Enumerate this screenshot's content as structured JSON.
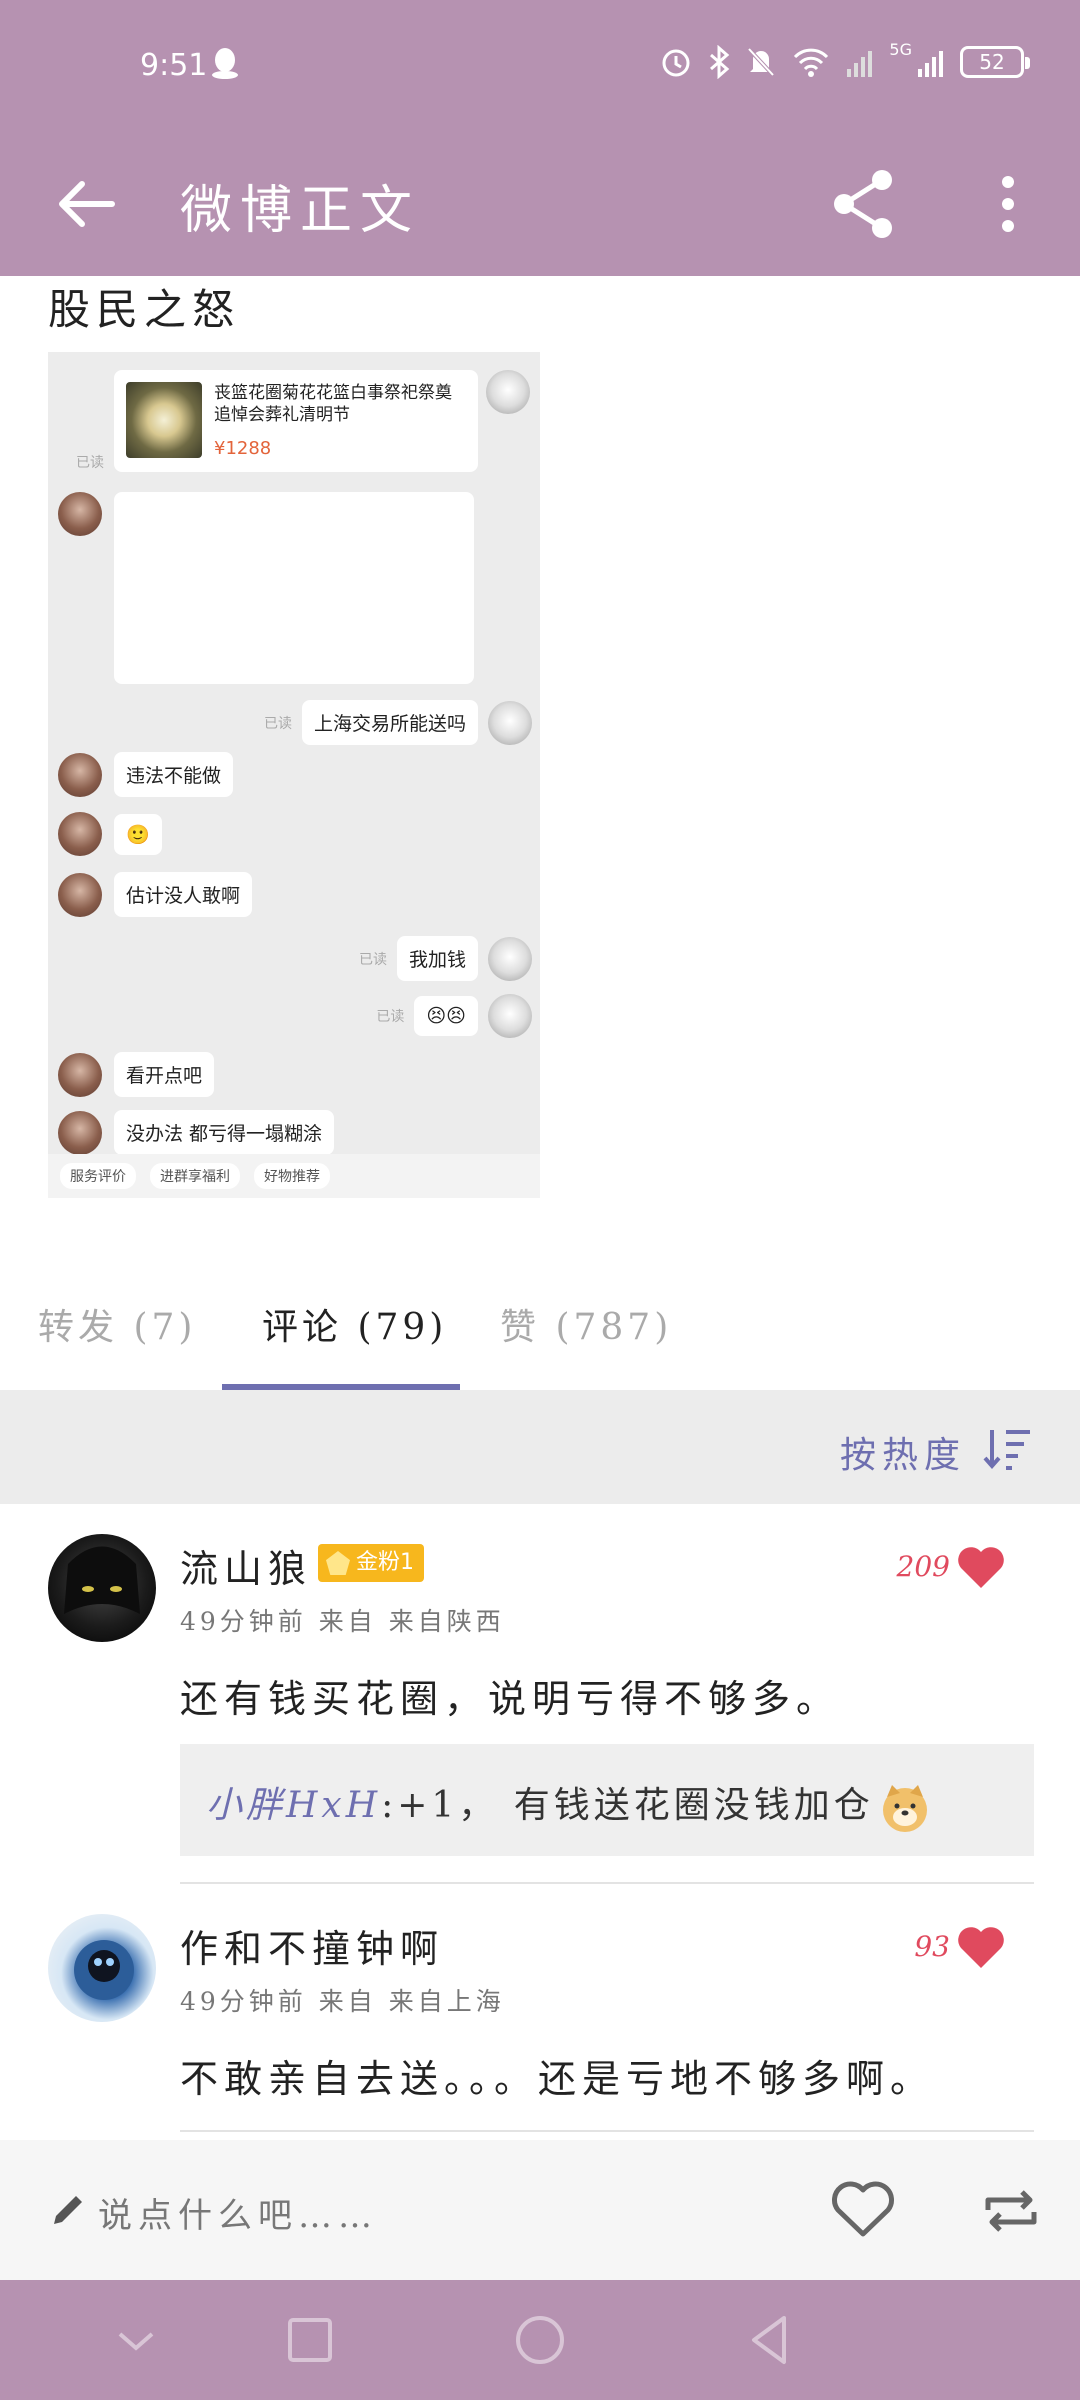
{
  "status_bar": {
    "time": "9:51",
    "battery": "52",
    "network": "5G"
  },
  "app_bar": {
    "title": "微博正文"
  },
  "post": {
    "text": "股民之怒",
    "chat": {
      "product_title": "丧篮花圈菊花花篮白事祭祀祭奠追悼会葬礼清明节",
      "product_price": "¥1288",
      "read_label": "已读",
      "messages": [
        {
          "side": "right",
          "text": "上海交易所能送吗"
        },
        {
          "side": "left",
          "text": "违法不能做"
        },
        {
          "side": "left",
          "text": "🙂"
        },
        {
          "side": "left",
          "text": "估计没人敢啊"
        },
        {
          "side": "right",
          "text": "我加钱"
        },
        {
          "side": "right",
          "text": "😣😣"
        },
        {
          "side": "left",
          "text": "看开点吧"
        },
        {
          "side": "left",
          "text": "没办法 都亏得一塌糊涂"
        }
      ],
      "bottom_chips": [
        "服务评价",
        "进群享福利",
        "好物推荐"
      ]
    }
  },
  "tabs": {
    "repost": "转发 (7)",
    "comments": "评论 (79)",
    "likes": "赞 (787)"
  },
  "sort": {
    "label": "按热度"
  },
  "comments": [
    {
      "name": "流山狼",
      "badge": "金粉1",
      "meta": "49分钟前 来自 来自陕西",
      "likes": "209",
      "body": "还有钱买花圈，说明亏得不够多。",
      "reply_user": "小胖HxH",
      "reply_text": ":+1， 有钱送花圈没钱加仓"
    },
    {
      "name": "作和不撞钟啊",
      "meta": "49分钟前 来自 来自上海",
      "likes": "93",
      "body": "不敢亲自去送。。。还是亏地不够多啊。"
    }
  ],
  "bottom_bar": {
    "placeholder": "说点什么吧……"
  },
  "colors": {
    "accent": "#b692b1",
    "link": "#6e6fb0",
    "like": "#e04a5e",
    "badge": "#f7b71d"
  }
}
